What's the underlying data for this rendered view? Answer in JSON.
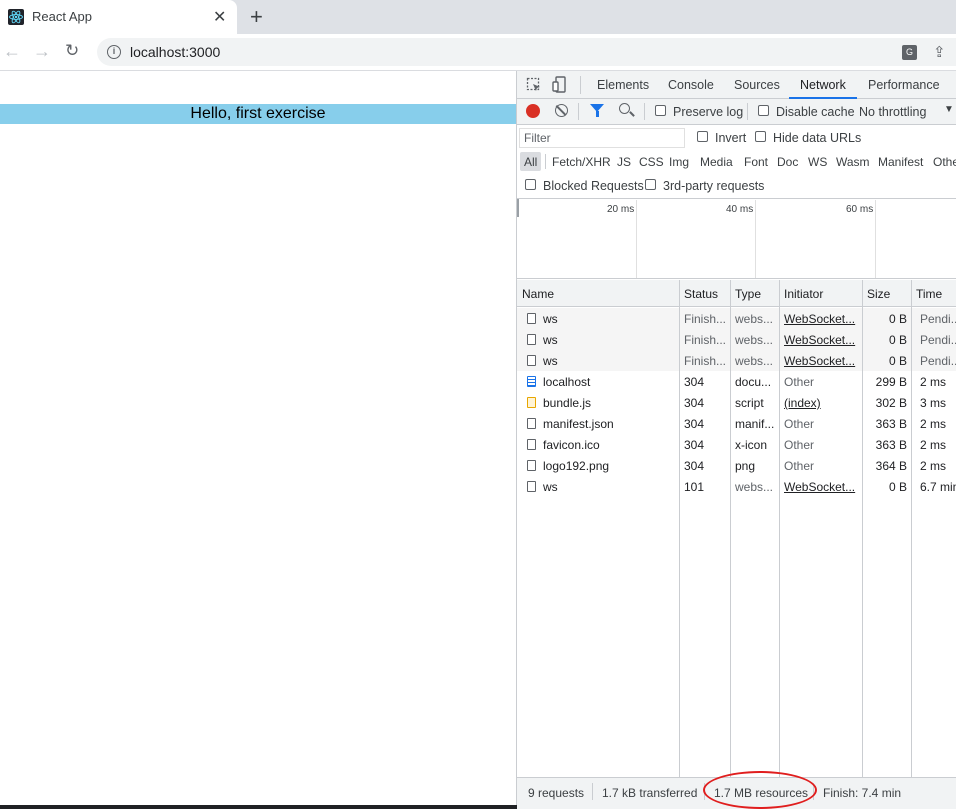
{
  "browser": {
    "tab_title": "React App",
    "url": "localhost:3000"
  },
  "page": {
    "hello_text": "Hello, first exercise",
    "hello_bg": "#87ceeb"
  },
  "devtools": {
    "tabs": [
      "Elements",
      "Console",
      "Sources",
      "Network",
      "Performance"
    ],
    "active_tab": "Network",
    "toolbar": {
      "preserve_log": "Preserve log",
      "disable_cache": "Disable cache",
      "throttling": "No throttling"
    },
    "filter": {
      "placeholder": "Filter",
      "invert": "Invert",
      "hide_data_urls": "Hide data URLs",
      "types": [
        "All",
        "Fetch/XHR",
        "JS",
        "CSS",
        "Img",
        "Media",
        "Font",
        "Doc",
        "WS",
        "Wasm",
        "Manifest",
        "Othe"
      ],
      "blocked_requests": "Blocked Requests",
      "third_party": "3rd-party requests"
    },
    "timeline_ticks": [
      "20 ms",
      "40 ms",
      "60 ms"
    ],
    "table": {
      "columns": [
        "Name",
        "Status",
        "Type",
        "Initiator",
        "Size",
        "Time"
      ],
      "rows": [
        {
          "name": "ws",
          "status": "Finish...",
          "type": "webs...",
          "initiator": "WebSocket...",
          "size": "0 B",
          "time": "Pendi...",
          "icon": "blank"
        },
        {
          "name": "ws",
          "status": "Finish...",
          "type": "webs...",
          "initiator": "WebSocket...",
          "size": "0 B",
          "time": "Pendi...",
          "icon": "blank"
        },
        {
          "name": "ws",
          "status": "Finish...",
          "type": "webs...",
          "initiator": "WebSocket...",
          "size": "0 B",
          "time": "Pendi...",
          "icon": "blank"
        },
        {
          "name": "localhost",
          "status": "304",
          "type": "docu...",
          "initiator": "Other",
          "size": "299 B",
          "time": "2 ms",
          "icon": "doc"
        },
        {
          "name": "bundle.js",
          "status": "304",
          "type": "script",
          "initiator": "(index)",
          "size": "302 B",
          "time": "3 ms",
          "icon": "js"
        },
        {
          "name": "manifest.json",
          "status": "304",
          "type": "manif...",
          "initiator": "Other",
          "size": "363 B",
          "time": "2 ms",
          "icon": "blank"
        },
        {
          "name": "favicon.ico",
          "status": "304",
          "type": "x-icon",
          "initiator": "Other",
          "size": "363 B",
          "time": "2 ms",
          "icon": "blank"
        },
        {
          "name": "logo192.png",
          "status": "304",
          "type": "png",
          "initiator": "Other",
          "size": "364 B",
          "time": "2 ms",
          "icon": "blank"
        },
        {
          "name": "ws",
          "status": "101",
          "type": "webs...",
          "initiator": "WebSocket...",
          "size": "0 B",
          "time": "6.7 min",
          "icon": "blank"
        }
      ]
    },
    "status": {
      "requests": "9 requests",
      "transferred": "1.7 kB transferred",
      "resources": "1.7 MB resources",
      "finish": "Finish: 7.4 min"
    }
  }
}
